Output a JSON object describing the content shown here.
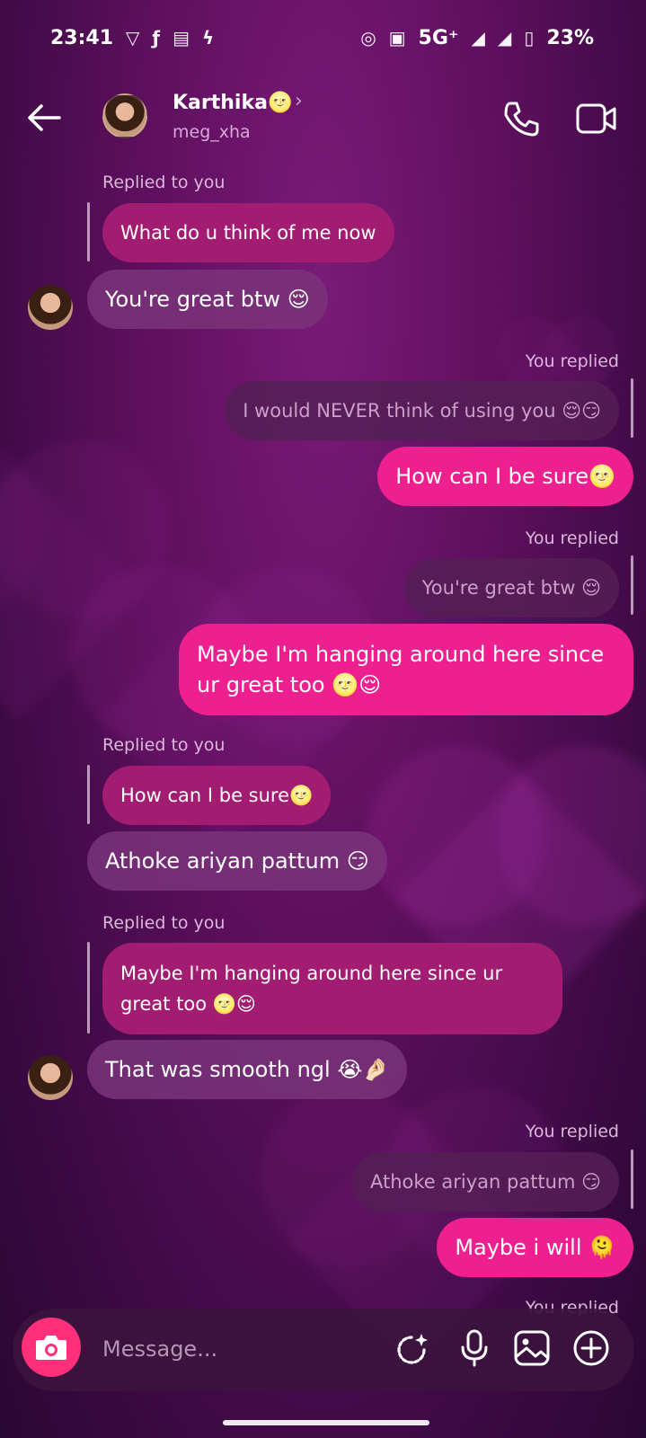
{
  "status": {
    "time": "23:41",
    "network": "5G⁺",
    "battery": "23%"
  },
  "header": {
    "name": "Karthika🌝",
    "chevron": "›",
    "username": "meg_xha"
  },
  "messages": {
    "m1_label": "Replied to you",
    "m1_quote": "What do u think of me now",
    "m1_text": "You're great btw 😌",
    "m2_label": "You replied",
    "m2_quote": "I would NEVER think of using you 😌😏",
    "m2_text": "How can I be sure🌝",
    "m3_label": "You replied",
    "m3_quote": "You're great btw 😌",
    "m3_text": "Maybe I'm hanging around here since ur great too 🌝😌",
    "m4_label": "Replied to you",
    "m4_quote": "How can I be sure🌝",
    "m4_text": "Athoke ariyan pattum 😏",
    "m5_label": "Replied to you",
    "m5_quote": "Maybe I'm hanging around here since ur great too 🌝😌",
    "m5_text": "That was smooth ngl 😭🤌🏻",
    "m6_label": "You replied",
    "m6_quote": "Athoke ariyan pattum 😏",
    "m6_text": "Maybe i will 🫠",
    "m7_label": "You replied"
  },
  "composer": {
    "placeholder": "Message..."
  },
  "colors": {
    "outgoing_bubble": "#ee1f8e",
    "incoming_bubble": "#7a347a",
    "quote_incoming": "#a21d72",
    "camera_button": "#ff2f7a"
  }
}
